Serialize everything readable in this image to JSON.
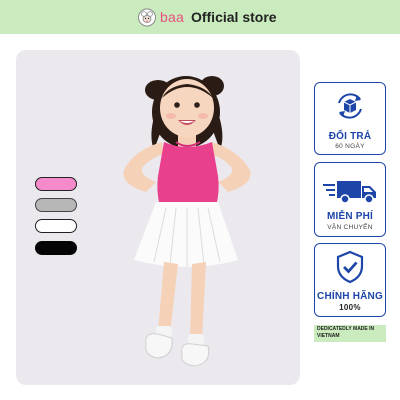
{
  "header": {
    "brand_name": "baa",
    "store_label": "Official store",
    "background_color": "#c9ebbd",
    "logo_icon": "sheep-icon"
  },
  "product": {
    "image_description": "girl-in-pink-tank-top-and-white-pleated-skirt",
    "color_swatches": [
      {
        "name": "pink",
        "color": "#f48ac9"
      },
      {
        "name": "gray",
        "color": "#b7b7b7"
      },
      {
        "name": "white",
        "color": "#ffffff"
      },
      {
        "name": "black",
        "color": "#050505"
      }
    ]
  },
  "badges": [
    {
      "icon": "box-return-icon",
      "title": "ĐỔI TRẢ",
      "subtitle": "60 NGÀY"
    },
    {
      "icon": "delivery-truck-icon",
      "title": "MIỄN PHÍ",
      "subtitle": "VẬN CHUYỂN"
    },
    {
      "icon": "shield-check-icon",
      "title": "CHÍNH HÃNG",
      "subtitle": "100%"
    }
  ],
  "footer_note": "DEDICATEDLY MADE IN VIETNAM",
  "accent_color": "#1d46a8"
}
